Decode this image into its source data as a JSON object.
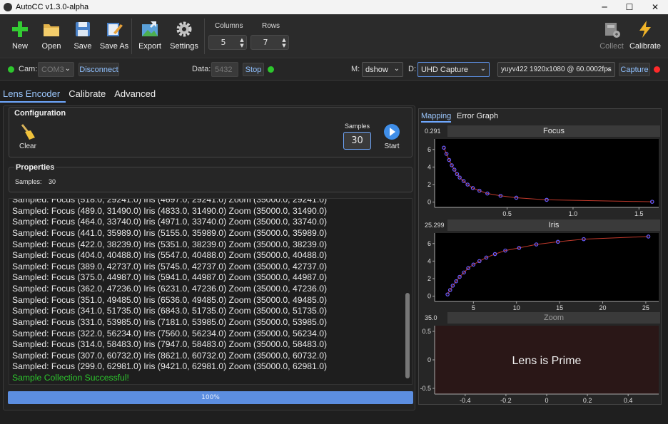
{
  "window": {
    "title": "AutoCC v1.3.0-alpha",
    "minimize": "─",
    "maximize": "☐",
    "close": "✕"
  },
  "toolbar": {
    "new": "New",
    "open": "Open",
    "save": "Save",
    "save_as": "Save As",
    "export": "Export",
    "settings": "Settings",
    "columns_label": "Columns",
    "columns_value": "5",
    "rows_label": "Rows",
    "rows_value": "7",
    "collect": "Collect",
    "calibrate": "Calibrate"
  },
  "connection": {
    "cam_label": "Cam:",
    "cam_value": "COM3",
    "disconnect": "Disconnect",
    "data_label": "Data:",
    "data_value": "5432",
    "stop": "Stop",
    "m_label": "M:",
    "m_value": "dshow",
    "d_label": "D:",
    "d_value": "UHD Capture",
    "format_value": "yuyv422 1920x1080 @ 60.0002fps",
    "capture": "Capture",
    "colors": {
      "connected": "#2dc62d",
      "recording": "#ff2a2a"
    }
  },
  "tabs": [
    "Lens Encoder",
    "Calibrate",
    "Advanced"
  ],
  "configuration": {
    "title": "Configuration",
    "clear": "Clear",
    "samples_label": "Samples",
    "samples_value": "30",
    "start": "Start"
  },
  "properties": {
    "title": "Properties",
    "samples_label": "Samples:",
    "samples_value": "30"
  },
  "log": [
    "Sampled: Focus (518.0, 29241.0) Iris (4697.0, 29241.0) Zoom (35000.0, 29241.0)",
    "Sampled: Focus (489.0, 31490.0) Iris (4833.0, 31490.0) Zoom (35000.0, 31490.0)",
    "Sampled: Focus (464.0, 33740.0) Iris (4971.0, 33740.0) Zoom (35000.0, 33740.0)",
    "Sampled: Focus (441.0, 35989.0) Iris (5155.0, 35989.0) Zoom (35000.0, 35989.0)",
    "Sampled: Focus (422.0, 38239.0) Iris (5351.0, 38239.0) Zoom (35000.0, 38239.0)",
    "Sampled: Focus (404.0, 40488.0) Iris (5547.0, 40488.0) Zoom (35000.0, 40488.0)",
    "Sampled: Focus (389.0, 42737.0) Iris (5745.0, 42737.0) Zoom (35000.0, 42737.0)",
    "Sampled: Focus (375.0, 44987.0) Iris (5941.0, 44987.0) Zoom (35000.0, 44987.0)",
    "Sampled: Focus (362.0, 47236.0) Iris (6231.0, 47236.0) Zoom (35000.0, 47236.0)",
    "Sampled: Focus (351.0, 49485.0) Iris (6536.0, 49485.0) Zoom (35000.0, 49485.0)",
    "Sampled: Focus (341.0, 51735.0) Iris (6843.0, 51735.0) Zoom (35000.0, 51735.0)",
    "Sampled: Focus (331.0, 53985.0) Iris (7181.0, 53985.0) Zoom (35000.0, 53985.0)",
    "Sampled: Focus (322.0, 56234.0) Iris (7560.0, 56234.0) Zoom (35000.0, 56234.0)",
    "Sampled: Focus (314.0, 58483.0) Iris (7947.0, 58483.0) Zoom (35000.0, 58483.0)",
    "Sampled: Focus (307.0, 60732.0) Iris (8621.0, 60732.0) Zoom (35000.0, 60732.0)",
    "Sampled: Focus (299.0, 62981.0) Iris (9421.0, 62981.0) Zoom (35000.0, 62981.0)"
  ],
  "log_success": "Sample Collection Successful!",
  "progress": {
    "percent": 100,
    "label": "100%"
  },
  "graph_tabs": [
    "Mapping",
    "Error Graph"
  ],
  "chart_data": [
    {
      "type": "scatter",
      "title": "Focus",
      "value_readout": "0.291",
      "xlim": [
        -0.05,
        1.65
      ],
      "ylim": [
        -0.6,
        7.2
      ],
      "xticks": [
        0.5,
        1.0,
        1.5
      ],
      "yticks": [
        0,
        2,
        4,
        6
      ],
      "xtick_labels": [
        "0.5",
        "1.0",
        "1.5"
      ],
      "ytick_labels": [
        "0",
        "2",
        "4",
        "6"
      ],
      "points": [
        [
          0.02,
          6.2
        ],
        [
          0.04,
          5.5
        ],
        [
          0.06,
          4.8
        ],
        [
          0.08,
          4.2
        ],
        [
          0.1,
          3.7
        ],
        [
          0.12,
          3.2
        ],
        [
          0.14,
          2.8
        ],
        [
          0.17,
          2.4
        ],
        [
          0.2,
          2.0
        ],
        [
          0.24,
          1.6
        ],
        [
          0.29,
          1.3
        ],
        [
          0.35,
          0.98
        ],
        [
          0.45,
          0.72
        ],
        [
          0.57,
          0.5
        ],
        [
          0.8,
          0.26
        ],
        [
          1.6,
          0.04
        ]
      ],
      "fit_color": "#c0392b",
      "point_color": "#6a5cff"
    },
    {
      "type": "scatter",
      "title": "Iris",
      "value_readout": "25.299",
      "xlim": [
        0.5,
        26.5
      ],
      "ylim": [
        -0.6,
        7.2
      ],
      "xticks": [
        5,
        10,
        15,
        20,
        25
      ],
      "yticks": [
        0,
        2,
        4,
        6
      ],
      "xtick_labels": [
        "5",
        "10",
        "15",
        "20",
        "25"
      ],
      "ytick_labels": [
        "0",
        "2",
        "4",
        "6"
      ],
      "points": [
        [
          2.0,
          0.2
        ],
        [
          2.3,
          0.7
        ],
        [
          2.6,
          1.2
        ],
        [
          3.0,
          1.7
        ],
        [
          3.4,
          2.2
        ],
        [
          3.9,
          2.7
        ],
        [
          4.4,
          3.2
        ],
        [
          5.0,
          3.6
        ],
        [
          5.7,
          4.0
        ],
        [
          6.5,
          4.4
        ],
        [
          7.5,
          4.8
        ],
        [
          8.7,
          5.2
        ],
        [
          10.3,
          5.5
        ],
        [
          12.3,
          5.9
        ],
        [
          14.8,
          6.2
        ],
        [
          17.8,
          6.5
        ],
        [
          25.3,
          6.8
        ]
      ],
      "fit_color": "#c0392b",
      "point_color": "#6a5cff"
    },
    {
      "type": "scatter",
      "title": "Zoom",
      "value_readout": "35.0",
      "xlim": [
        -0.55,
        0.55
      ],
      "ylim": [
        -0.6,
        0.6
      ],
      "xticks": [
        -0.4,
        -0.2,
        0,
        0.2,
        0.4
      ],
      "yticks": [
        0.5,
        0,
        -0.5
      ],
      "xtick_labels": [
        "-0.4",
        "-0.2",
        "0",
        "0.2",
        "0.4"
      ],
      "ytick_labels": [
        "0.5",
        "0",
        "-0.5"
      ],
      "points": [],
      "message": "Lens is Prime"
    }
  ]
}
